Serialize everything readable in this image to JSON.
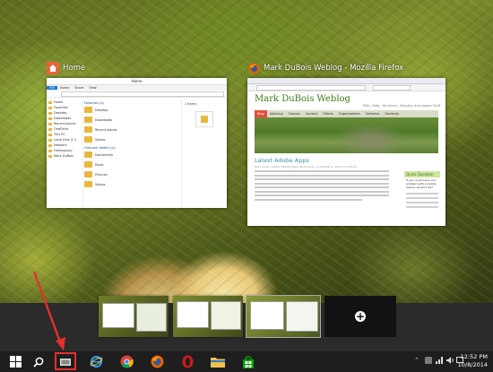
{
  "windows": {
    "explorer": {
      "title": "Home",
      "window_title": "Home",
      "ribbon_tabs": [
        "File",
        "Home",
        "Share",
        "View"
      ],
      "favorites_header": "Favorites (4)",
      "favorites": [
        "Desktop",
        "Downloads",
        "Recent places",
        "Videos"
      ],
      "nav_items": [
        "Home",
        "Favorites",
        "Desktop",
        "Downloads",
        "Recent places",
        "OneDrive",
        "This PC",
        "Local Disk (C:)",
        "Network",
        "Homegroup",
        "Mark DuBois"
      ],
      "frequent_header": "Frequent folders (4)",
      "frequent": [
        "Documents",
        "Music",
        "Pictures",
        "Videos"
      ],
      "recent_header": "1 items"
    },
    "firefox": {
      "title": "Mark DuBois Weblog - Mozilla Firefox",
      "blog_title": "Mark DuBois Weblog",
      "blog_subtitle": "PhD., Zeta - Its Inform, Educate, and Inspire Stuff",
      "nav": [
        "Blog",
        "Advising",
        "Classes",
        "Contact",
        "Efforts",
        "Organizations",
        "Software",
        "Students"
      ],
      "post_title": "Latest Adobe Apps",
      "post_meta": "Filed under: Adobe, Mobile Apps, Technology on October 8, 2014 at 5:00 pm",
      "quick_title": "Quick Question",
      "quick_body": "If you could solve one problem with a mobile device, would it be?"
    }
  },
  "virtual_desktops": {
    "add_label": "+"
  },
  "taskbar": {
    "time": "12:52 PM",
    "date": "10/8/2014"
  },
  "annotation": {
    "color": "#e5302b",
    "target": "task-view-button"
  },
  "colors": {
    "taskbar": "#1e1e1e",
    "blog_green": "#3d7a1c",
    "accent_blue": "#1979ca"
  }
}
